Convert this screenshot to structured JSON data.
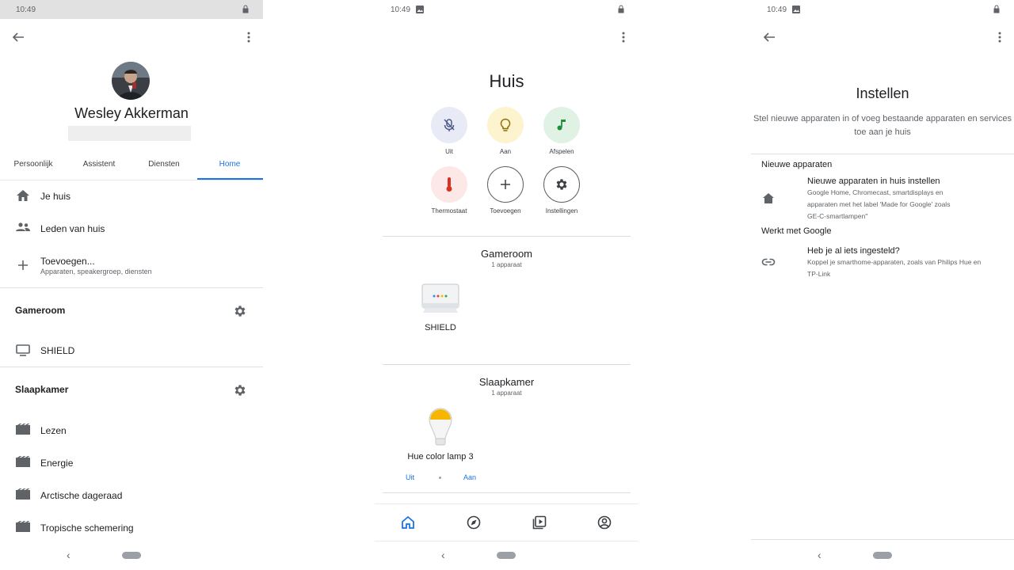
{
  "status_bar": {
    "time": "10:49"
  },
  "profile_panel": {
    "user_name": "Wesley Akkerman",
    "tabs": [
      "Persoonlijk",
      "Assistent",
      "Diensten",
      "Home"
    ],
    "active_tab": "Home",
    "items": {
      "je_huis": "Je huis",
      "leden": "Leden van huis",
      "toevoegen": "Toevoegen...",
      "toevoegen_sub": "Apparaten, speakergroep, diensten"
    },
    "rooms": [
      {
        "name": "Gameroom",
        "devices": [
          "SHIELD"
        ]
      },
      {
        "name": "Slaapkamer",
        "devices": [
          "Lezen",
          "Energie",
          "Arctische dageraad",
          "Tropische schemering"
        ]
      }
    ]
  },
  "home_panel": {
    "title": "Huis",
    "actions": [
      {
        "label": "Uit",
        "icon": "mic-off-icon",
        "bg": "#e8eaf6"
      },
      {
        "label": "Aan",
        "icon": "lightbulb-icon",
        "bg": "#fdf3cf"
      },
      {
        "label": "Afspelen",
        "icon": "music-note-icon",
        "bg": "#e0f2e4"
      },
      {
        "label": "Thermostaat",
        "icon": "thermometer-icon",
        "bg": "#fce8e6"
      },
      {
        "label": "Toevoegen",
        "icon": "plus-icon",
        "bg": "#ffffff"
      },
      {
        "label": "Instellingen",
        "icon": "gear-icon",
        "bg": "#ffffff"
      }
    ],
    "rooms": [
      {
        "name": "Gameroom",
        "count": "1 apparaat",
        "device": "SHIELD"
      },
      {
        "name": "Slaapkamer",
        "count": "1 apparaat",
        "device": "Hue color lamp 3",
        "off_label": "Uit",
        "on_label": "Aan"
      }
    ]
  },
  "setup_panel": {
    "title": "Instellen",
    "description_line1": "Stel nieuwe apparaten in of voeg bestaande apparaten en services",
    "description_line2": "toe aan je huis",
    "sections": [
      {
        "heading": "Nieuwe apparaten",
        "item_title": "Nieuwe apparaten in huis instellen",
        "item_desc_lines": [
          "Google Home, Chromecast, smartdisplays en",
          "apparaten met het label 'Made for Google' zoals",
          "GE-C-smartlampen\""
        ]
      },
      {
        "heading": "Werkt met Google",
        "item_title": "Heb je al iets ingesteld?",
        "item_desc_lines": [
          "Koppel je smarthome-apparaten, zoals van Philips Hue en",
          "TP-Link"
        ]
      }
    ]
  },
  "colors": {
    "accent": "#1a73e8",
    "text": "#202124",
    "secondary": "#5f6368"
  }
}
